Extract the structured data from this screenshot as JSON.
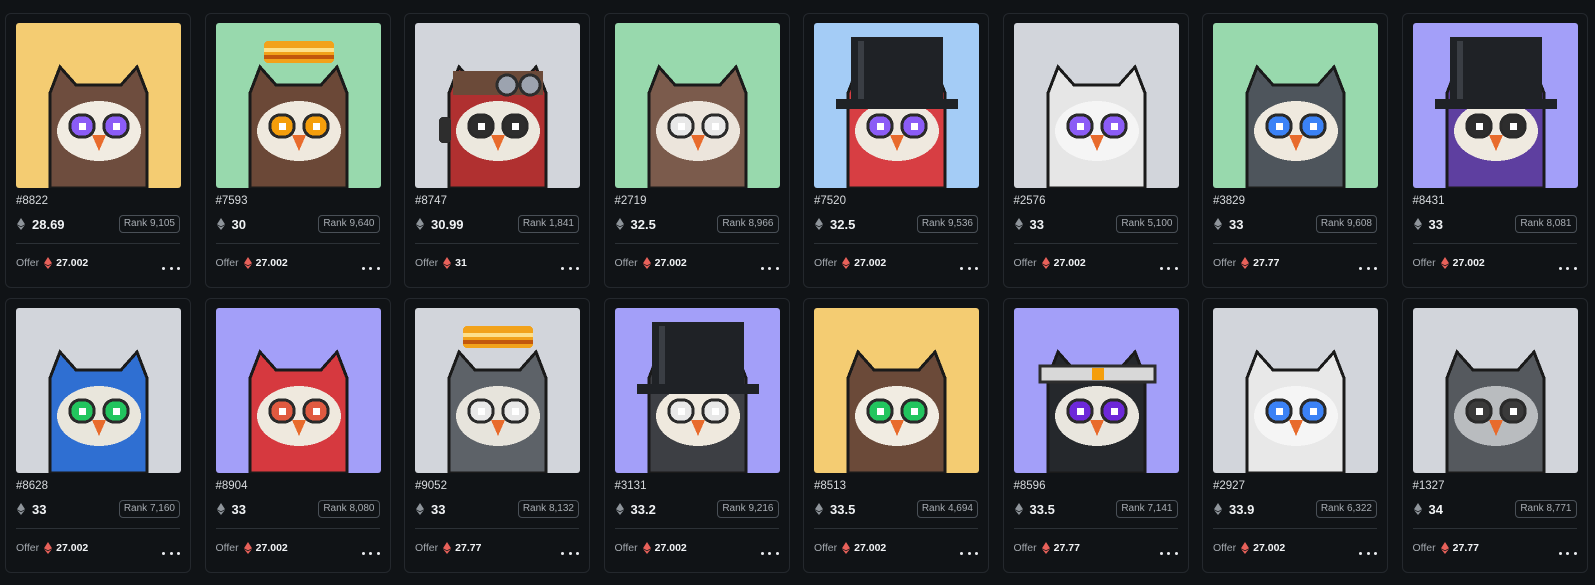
{
  "offer_label": "Offer",
  "rank_prefix": "Rank",
  "colors": {
    "background": "#101316",
    "yellow": "#f4cc72",
    "green": "#98d9ad",
    "gray": "#d2d5db",
    "blue": "#a4ccf6",
    "purple": "#a39ff9",
    "eth_red": "#e8615a"
  },
  "cards": [
    {
      "id": "#8822",
      "price": "28.69",
      "rank": "9,105",
      "offer": "27.002",
      "bg": "yellow",
      "body": "#6e4d3e",
      "face": "#f1ece2",
      "eye": "#8b5cf6",
      "hat": "none"
    },
    {
      "id": "#7593",
      "price": "30",
      "rank": "9,640",
      "offer": "27.002",
      "bg": "green",
      "body": "#6b4837",
      "face": "#efe9de",
      "eye": "#f59e0b",
      "hat": "halo"
    },
    {
      "id": "#8747",
      "price": "30.99",
      "rank": "1,841",
      "offer": "31",
      "bg": "gray",
      "body": "#b03030",
      "face": "#ece8de",
      "eye": "#2d2d2d",
      "hat": "aviator"
    },
    {
      "id": "#2719",
      "price": "32.5",
      "rank": "8,966",
      "offer": "27.002",
      "bg": "green",
      "body": "#7b5b4c",
      "face": "#ece5dc",
      "eye": "#e8e8e8",
      "hat": "none"
    },
    {
      "id": "#7520",
      "price": "32.5",
      "rank": "9,536",
      "offer": "27.002",
      "bg": "blue",
      "body": "#d73e43",
      "face": "#efe9df",
      "eye": "#8b5cf6",
      "hat": "tophat"
    },
    {
      "id": "#2576",
      "price": "33",
      "rank": "5,100",
      "offer": "27.002",
      "bg": "gray",
      "body": "#e6e6e6",
      "face": "#f5f5f5",
      "eye": "#8b5cf6",
      "hat": "none"
    },
    {
      "id": "#3829",
      "price": "33",
      "rank": "9,608",
      "offer": "27.77",
      "bg": "green",
      "body": "#4e555c",
      "face": "#efe9de",
      "eye": "#3b82f6",
      "hat": "none"
    },
    {
      "id": "#8431",
      "price": "33",
      "rank": "8,081",
      "offer": "27.002",
      "bg": "purple",
      "body": "#5e3fa0",
      "face": "#efeae0",
      "eye": "#2d2d2d",
      "hat": "tophat"
    },
    {
      "id": "#8628",
      "price": "33",
      "rank": "7,160",
      "offer": "27.002",
      "bg": "gray",
      "body": "#2f6fd2",
      "face": "#e9e6dc",
      "eye": "#22c55e",
      "hat": "none"
    },
    {
      "id": "#8904",
      "price": "33",
      "rank": "8,080",
      "offer": "27.002",
      "bg": "purple",
      "body": "#d6393f",
      "face": "#efe9de",
      "eye": "#e05a40",
      "hat": "none"
    },
    {
      "id": "#9052",
      "price": "33",
      "rank": "8,132",
      "offer": "27.77",
      "bg": "gray",
      "body": "#5d6268",
      "face": "#e7e4dc",
      "eye": "#e8e8e8",
      "hat": "halo"
    },
    {
      "id": "#3131",
      "price": "33.2",
      "rank": "9,216",
      "offer": "27.002",
      "bg": "purple",
      "body": "#3d3f44",
      "face": "#efe9de",
      "eye": "#e8e8e8",
      "hat": "tophat"
    },
    {
      "id": "#8513",
      "price": "33.5",
      "rank": "4,694",
      "offer": "27.002",
      "bg": "yellow",
      "body": "#6b4a39",
      "face": "#f1ece2",
      "eye": "#22c55e",
      "hat": "none"
    },
    {
      "id": "#8596",
      "price": "33.5",
      "rank": "7,141",
      "offer": "27.77",
      "bg": "purple",
      "body": "#25282c",
      "face": "#e9e6de",
      "eye": "#6d28d9",
      "hat": "headband"
    },
    {
      "id": "#2927",
      "price": "33.9",
      "rank": "6,322",
      "offer": "27.002",
      "bg": "gray",
      "body": "#e8e8e8",
      "face": "#f5f5f5",
      "eye": "#3b82f6",
      "hat": "none"
    },
    {
      "id": "#1327",
      "price": "34",
      "rank": "8,771",
      "offer": "27.77",
      "bg": "gray",
      "body": "#55595e",
      "face": "#b9bcbf",
      "eye": "#3a3a3a",
      "hat": "none"
    }
  ]
}
